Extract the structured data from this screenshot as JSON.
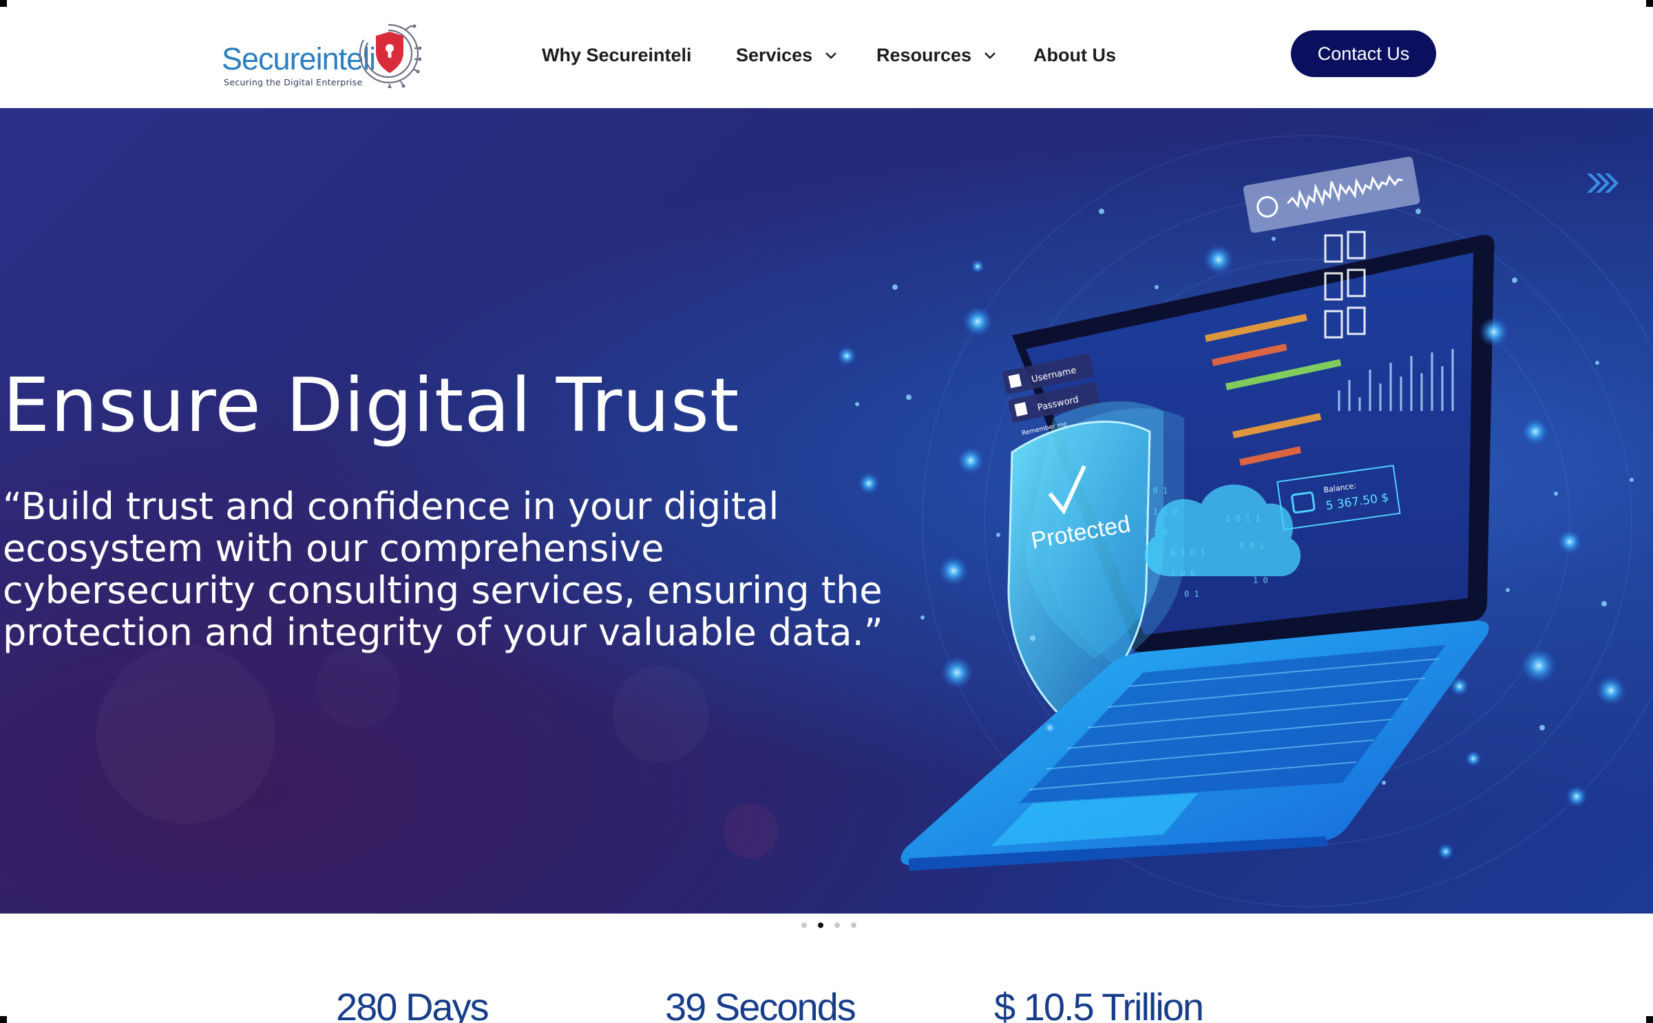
{
  "brand": {
    "name": "Secureinteli",
    "tagline": "Securing the Digital Enterprise"
  },
  "nav": {
    "items": [
      {
        "label": "Why Secureinteli",
        "has_dropdown": false
      },
      {
        "label": "Services",
        "has_dropdown": true
      },
      {
        "label": "Resources",
        "has_dropdown": true
      },
      {
        "label": "About Us",
        "has_dropdown": false
      }
    ],
    "cta": "Contact Us"
  },
  "hero": {
    "title": "Ensure Digital Trust",
    "quote": "“Build trust and confidence in your digital ecosystem with our comprehensive cybersecurity consulting services, ensuring the protection and integrity of your valuable data.”",
    "illustration": {
      "login_username": "Username",
      "login_password": "Password",
      "remember": "Remember me",
      "shield_label": "Protected",
      "balance_label": "Balance:",
      "balance_value": "5 367.50 $"
    }
  },
  "carousel": {
    "slide_count": 4,
    "active_index": 1
  },
  "stats": [
    {
      "value": "280 Days"
    },
    {
      "value": "39 Seconds"
    },
    {
      "value": "$ 10.5 Trillion"
    }
  ],
  "colors": {
    "brand_blue": "#2b7fc1",
    "cta_bg": "#0a0f5e",
    "stat_text": "#173d8a",
    "hero_bg": "#262a78",
    "shield_red": "#d92b3a"
  }
}
